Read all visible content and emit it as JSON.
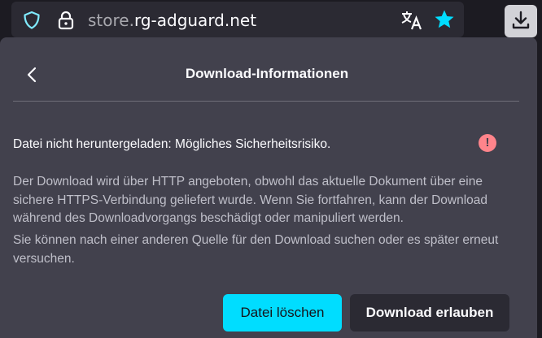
{
  "urlbar": {
    "url_host_prefix": "store.",
    "url_host_main": "rg-adguard.net",
    "shield_icon": "shield-icon",
    "lock_icon": "lock-icon",
    "translate_icon": "translate-icon",
    "bookmark_icon": "star-icon"
  },
  "toolbar": {
    "download_icon": "download-icon"
  },
  "panel": {
    "title": "Download-Informationen",
    "back_icon": "chevron-left-icon",
    "warning_text": "Datei nicht heruntergeladen: Mögliches Sicherheitsrisiko.",
    "warning_icon_glyph": "!",
    "description_1": "Der Download wird über HTTP angeboten, obwohl das aktuelle Dokument über eine sichere HTTPS-Verbindung geliefert wurde. Wenn Sie fortfahren, kann der Download während des Downloadvorgangs beschädigt oder manipuliert werden.",
    "description_2": "Sie können nach einer anderen Quelle für den Download suchen oder es später erneut versuchen.",
    "delete_button": "Datei löschen",
    "allow_button": "Download erlauben"
  },
  "colors": {
    "accent": "#00ddff",
    "bookmark_star": "#00ddff",
    "warning": "#ff848b",
    "panel_bg": "#42414d",
    "toolbar_bg": "#1c1b22"
  }
}
